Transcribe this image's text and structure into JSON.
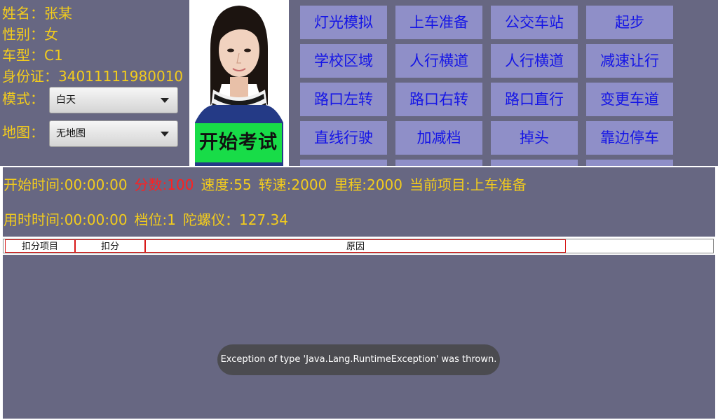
{
  "candidate": {
    "name_line": "姓名：张某",
    "gender_line": "性别：女",
    "car_type_line": "车型：C1",
    "id_line": "身份证：34011111980010"
  },
  "mode": {
    "label": "模式：",
    "selected": "白天"
  },
  "map": {
    "label": "地图：",
    "selected": "无地图"
  },
  "start_exam_label": "开始考试",
  "exam_items": [
    "灯光模拟",
    "上车准备",
    "公交车站",
    "起步",
    "学校区域",
    "人行横道",
    "人行横道",
    "减速让行",
    "路口左转",
    "路口右转",
    "路口直行",
    "变更车道",
    "直线行驶",
    "加减档",
    "掉头",
    "靠边停车"
  ],
  "status": {
    "start_time": "开始时间:00:00:00",
    "score": "分数:100",
    "speed": "速度:55",
    "rpm": "转速:2000",
    "mileage": "里程:2000",
    "current_item": "当前项目:上车准备",
    "elapsed_time": "用时时间:00:00:00",
    "gear": "档位:1",
    "gyro": "陀螺仪：127.34"
  },
  "table_headers": {
    "item": "扣分项目",
    "points": "扣分",
    "reason": "原因"
  },
  "toast_message": "Exception of type 'Java.Lang.RuntimeException' was thrown.",
  "colors": {
    "panel": "#676782",
    "info_text": "#f3cc1c",
    "score_text": "#ff2020",
    "button_bg": "#8f8fc8",
    "button_text": "#1515e6",
    "start_button": "#18dc48"
  }
}
